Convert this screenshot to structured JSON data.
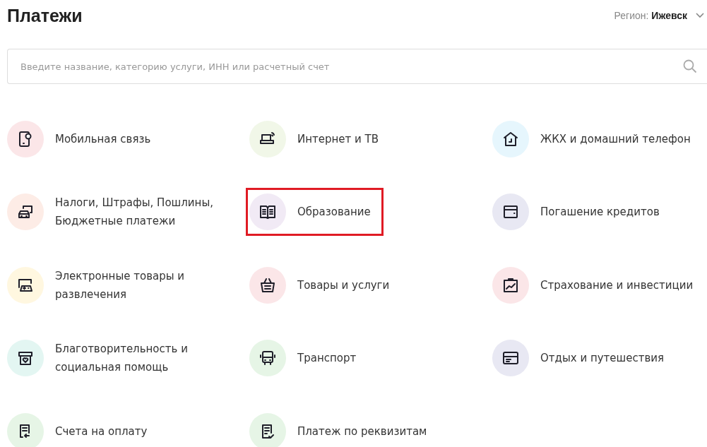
{
  "page": {
    "title": "Платежи"
  },
  "region": {
    "label": "Регион:",
    "value": "Ижевск"
  },
  "search": {
    "placeholder": "Введите название, категорию услуги, ИНН или расчетный счет"
  },
  "categories": [
    {
      "label": "Мобильная связь",
      "color": "#fbe6e8",
      "highlighted": false
    },
    {
      "label": "Интернет и ТВ",
      "color": "#f1f7e8",
      "highlighted": false
    },
    {
      "label": "ЖКХ и домашний телефон",
      "color": "#e6f6fd",
      "highlighted": false
    },
    {
      "label": "Налоги, Штрафы, Пошлины, Бюджетные платежи",
      "color": "#fdece6",
      "highlighted": false
    },
    {
      "label": "Образование",
      "color": "#f1eaf5",
      "highlighted": true
    },
    {
      "label": "Погашение кредитов",
      "color": "#e8e8f3",
      "highlighted": false
    },
    {
      "label": "Электронные товары и развлечения",
      "color": "#fff7e0",
      "highlighted": false
    },
    {
      "label": "Товары и услуги",
      "color": "#fbe6e8",
      "highlighted": false
    },
    {
      "label": "Страхование и инвестиции",
      "color": "#fbe6e8",
      "highlighted": false
    },
    {
      "label": "Благотворительность и социальная помощь",
      "color": "#e3f6f2",
      "highlighted": false
    },
    {
      "label": "Транспорт",
      "color": "#e6f5e6",
      "highlighted": false
    },
    {
      "label": "Отдых и путешествия",
      "color": "#e8e8f3",
      "highlighted": false
    },
    {
      "label": "Счета на оплату",
      "color": "#e6f5e6",
      "highlighted": false
    },
    {
      "label": "Платеж по реквизитам",
      "color": "#e6f5e6",
      "highlighted": false
    }
  ]
}
